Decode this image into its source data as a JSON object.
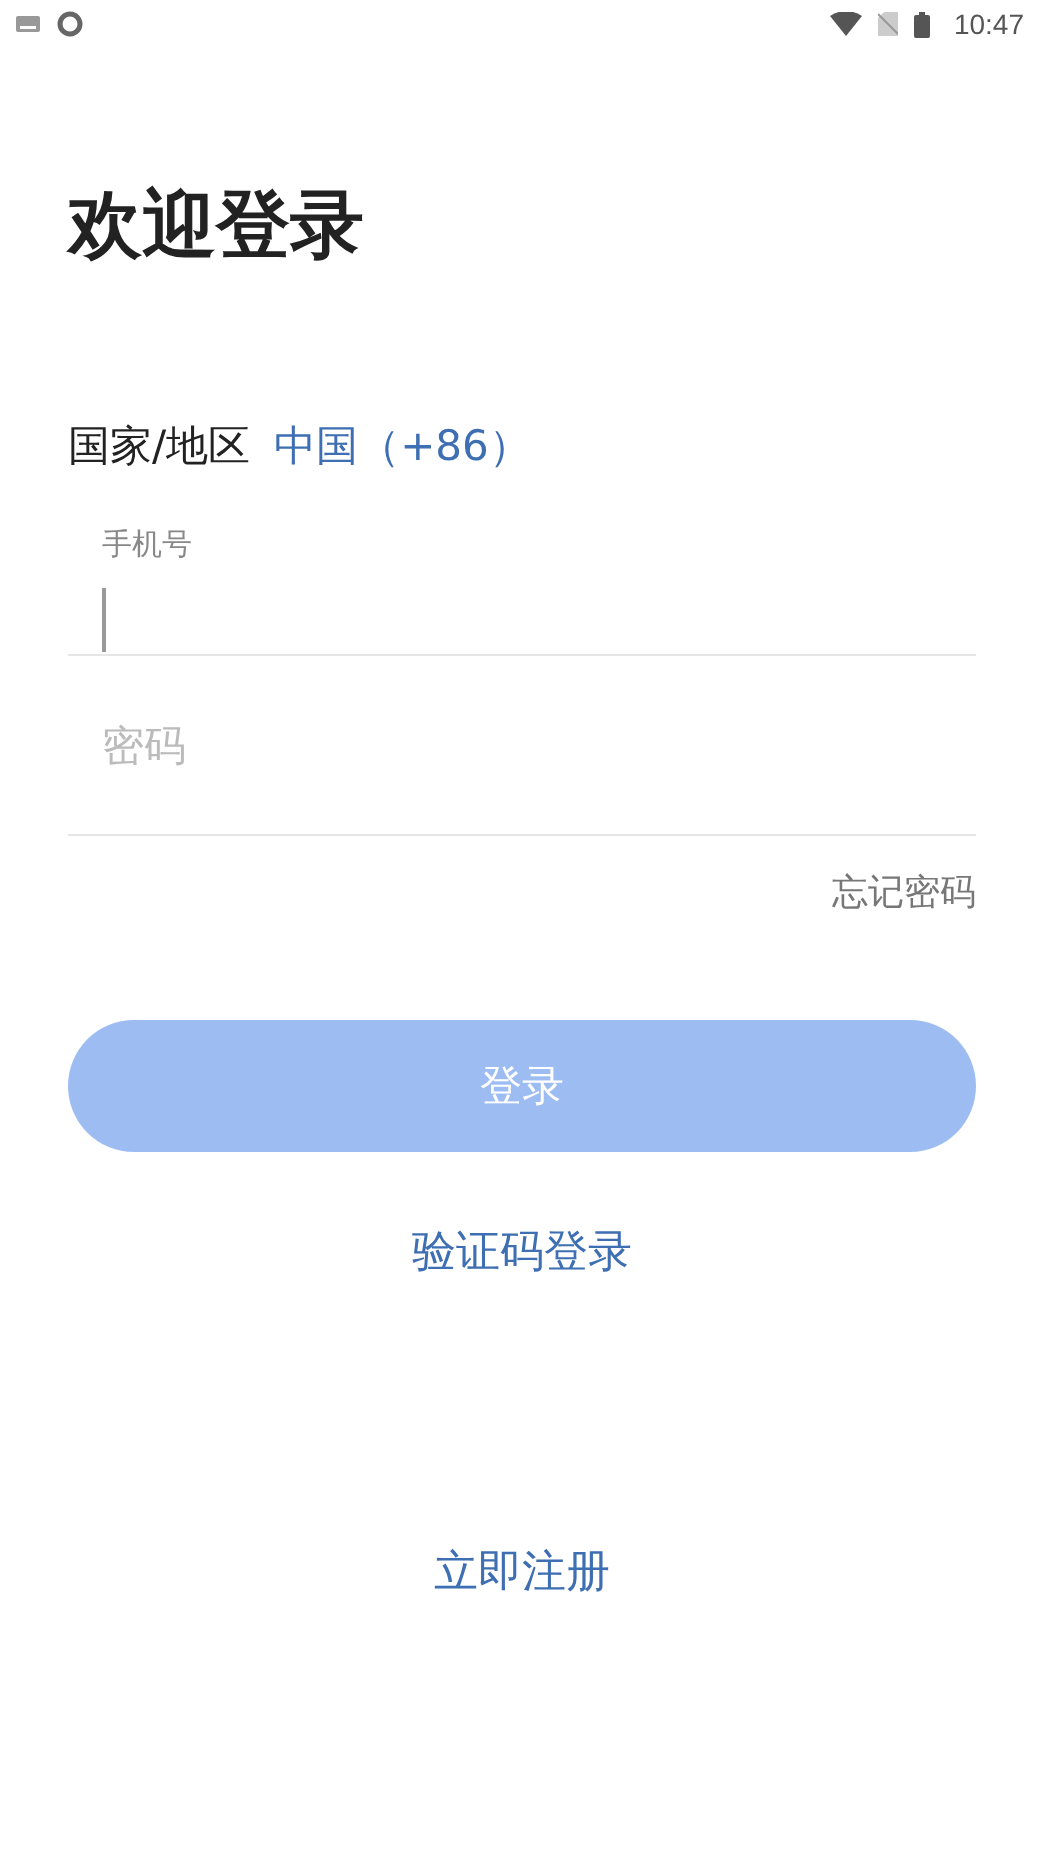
{
  "status_bar": {
    "time": "10:47"
  },
  "title": "欢迎登录",
  "region": {
    "label": "国家/地区",
    "value": "中国（+86）"
  },
  "phone_field": {
    "label": "手机号",
    "focused": true
  },
  "password_field": {
    "placeholder": "密码"
  },
  "forgot_link": "忘记密码",
  "login_button": {
    "label": "登录",
    "disabled": true
  },
  "sms_login_link": "验证码登录",
  "register_link": "立即注册"
}
